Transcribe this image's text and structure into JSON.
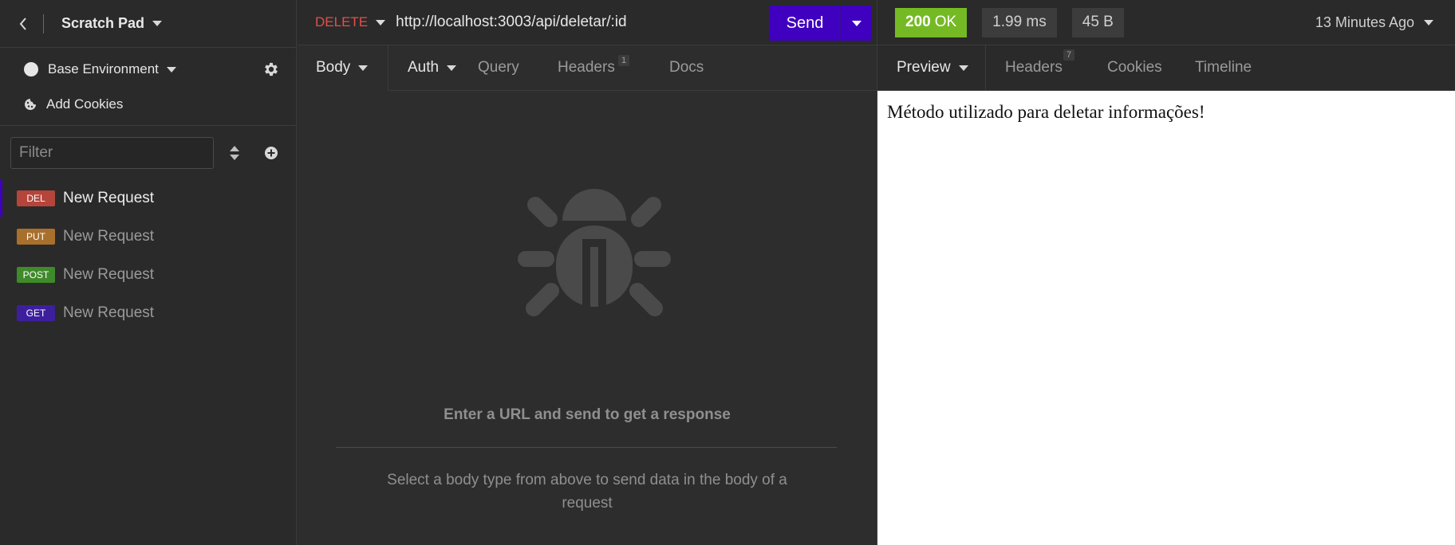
{
  "sidebar": {
    "workspace": "Scratch Pad",
    "environment": "Base Environment",
    "cookies_label": "Add Cookies",
    "filter_placeholder": "Filter",
    "requests": [
      {
        "method": "DEL",
        "label": "New Request",
        "color": "#b5453b",
        "active": true
      },
      {
        "method": "PUT",
        "label": "New Request",
        "color": "#a8702c",
        "active": false
      },
      {
        "method": "POST",
        "label": "New Request",
        "color": "#3f8a2a",
        "active": false
      },
      {
        "method": "GET",
        "label": "New Request",
        "color": "#3d1f9e",
        "active": false
      }
    ]
  },
  "request": {
    "method": "DELETE",
    "url": "http://localhost:3003/api/deletar/:id",
    "send_label": "Send",
    "tabs": {
      "body": "Body",
      "auth": "Auth",
      "query": "Query",
      "headers": "Headers",
      "headers_count": "1",
      "docs": "Docs"
    },
    "empty_title": "Enter a URL and send to get a response",
    "empty_desc": "Select a body type from above to send data in the body of a request"
  },
  "response": {
    "status_code": "200",
    "status_text": "OK",
    "time": "1.99 ms",
    "size": "45 B",
    "ago": "13 Minutes Ago",
    "tabs": {
      "preview": "Preview",
      "headers": "Headers",
      "headers_count": "7",
      "cookies": "Cookies",
      "timeline": "Timeline"
    },
    "body_text": "Método utilizado para deletar informações!"
  },
  "colors": {
    "accent": "#4000bf",
    "success": "#75ba24",
    "delete_method": "#e0514b"
  }
}
